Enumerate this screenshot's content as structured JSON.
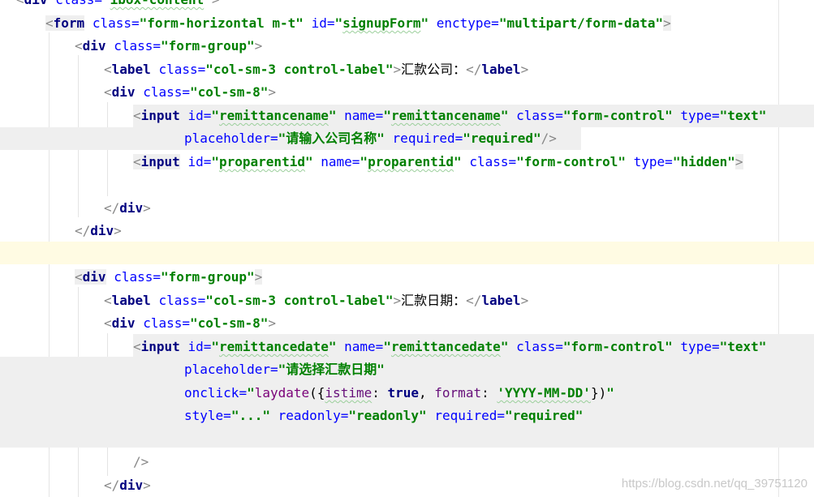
{
  "editor": {
    "watermark": "https://blog.csdn.net/qq_39751120",
    "lines": [
      {
        "text_pre": "<div class=\"",
        "text_val": "ibox-content",
        "text_post": "\">"
      },
      {
        "tag": "form",
        "class_val": "form-horizontal m-t",
        "id_val": "signupForm",
        "enctype_val": "multipart/form-data"
      },
      {
        "tag": "div",
        "class_val": "form-group"
      },
      {
        "tag": "label",
        "class_val": "col-sm-3 control-label",
        "text": "汇款公司：",
        "close": "label"
      },
      {
        "tag": "div",
        "class_val": "col-sm-8"
      },
      {
        "tag": "input",
        "id_val": "remittancename",
        "name_val": "remittancename",
        "class_val": "form-control",
        "type_val": "text"
      },
      {
        "placeholder_val": "请输入公司名称",
        "required_val": "required"
      },
      {
        "tag": "input",
        "id_val": "proparentid",
        "name_val": "proparentid",
        "class_val": "form-control",
        "type_val": "hidden"
      },
      {
        "close": "div"
      },
      {
        "close": "div"
      },
      {
        "tag": "div",
        "class_val": "form-group"
      },
      {
        "tag": "label",
        "class_val": "col-sm-3 control-label",
        "text": "汇款日期：",
        "close": "label"
      },
      {
        "tag": "div",
        "class_val": "col-sm-8"
      },
      {
        "tag": "input",
        "id_val": "remittancedate",
        "name_val": "remittancedate",
        "class_val": "form-control",
        "type_val": "text"
      },
      {
        "placeholder_val": "请选择汇款日期"
      },
      {
        "onclick_fn": "laydate",
        "onclick_key1": "istime",
        "onclick_val1": "true",
        "onclick_key2": "format",
        "onclick_val2": "'YYYY-MM-DD'"
      },
      {
        "style_val": "...",
        "readonly_val": "readonly",
        "required_val": "required"
      },
      {
        "selfclose": "/>"
      },
      {
        "close": "div"
      }
    ],
    "attr_names": {
      "class": "class",
      "id": "id",
      "enctype": "enctype",
      "name": "name",
      "type": "type",
      "placeholder": "placeholder",
      "required": "required",
      "onclick": "onclick",
      "style": "style",
      "readonly": "readonly"
    }
  }
}
